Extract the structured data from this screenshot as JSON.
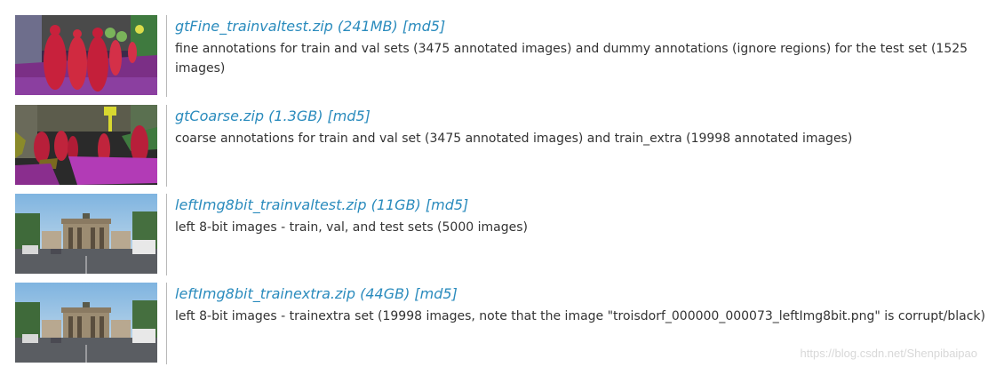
{
  "rows": [
    {
      "link": "gtFine_trainvaltest.zip (241MB) [md5]",
      "description": "fine annotations for train and val sets (3475 annotated images) and dummy annotations (ignore regions) for the test set (1525 images)"
    },
    {
      "link": "gtCoarse.zip (1.3GB) [md5]",
      "description": "coarse annotations for train and val set (3475 annotated images) and train_extra (19998 annotated images)"
    },
    {
      "link": "leftImg8bit_trainvaltest.zip (11GB) [md5]",
      "description": "left 8-bit images - train, val, and test sets (5000 images)"
    },
    {
      "link": "leftImg8bit_trainextra.zip (44GB) [md5]",
      "description": "left 8-bit images - trainextra set (19998 images, note that the image \"troisdorf_000000_000073_leftImg8bit.png\" is corrupt/black)"
    }
  ],
  "watermark": "https://blog.csdn.net/Shenpibaipao",
  "colors": {
    "link": "#2a8bbd",
    "text": "#333333",
    "divider": "#b8b8b8"
  }
}
